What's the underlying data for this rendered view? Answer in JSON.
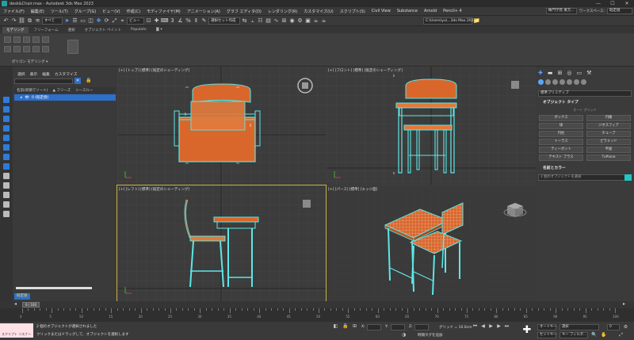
{
  "window": {
    "title": "desk&Chair.max - Autodesk 3ds Max 2023",
    "controls": [
      "—",
      "☐",
      "✕"
    ]
  },
  "menu": {
    "items": [
      "ファイル(F)",
      "編集(E)",
      "ツール(T)",
      "グループ(G)",
      "ビュー(V)",
      "作成(C)",
      "モディファイヤ(M)",
      "アニメーション(A)",
      "グラフ エディタ(D)",
      "レンダリング(R)",
      "カスタマイズ(U)",
      "スクリプト(S)",
      "Civil View",
      "Substance",
      "Arnold",
      "Pencil+ 4"
    ],
    "user_field": "株門学苑 東方...",
    "workspace_label": "ワークスペース:",
    "workspace_value": "既定値"
  },
  "toolbar": {
    "filter": "すべて",
    "selection_set": "選択セット作成",
    "path": "C:\\Users\\yu\\...3ds Max 2023"
  },
  "ribbon": {
    "tabs": [
      "モデリング",
      "フリーフォーム",
      "選択",
      "オブジェクト ペイント",
      "Populate"
    ],
    "active_tab": 0,
    "group_label": "ポリゴン モデリング ▾"
  },
  "scene_explorer": {
    "tabs": [
      "選択",
      "表示",
      "編集",
      "カスタマイズ"
    ],
    "header": [
      "名前(昇順でソート)",
      "▲ フリーズ",
      "シースルー"
    ],
    "row_label": "0 (既定値)",
    "status": "既定値"
  },
  "viewports": [
    {
      "label": "[+] [トップ] [標準] [既定のシェーディング]"
    },
    {
      "label": "[+] [フロント] [標準] [既定のシェーディング]"
    },
    {
      "label": "[+] [レフト] [標準] [既定のシェーディング]"
    },
    {
      "label": "[+] [パース] [標準] [エッジ面]"
    }
  ],
  "command_panel": {
    "dropdown": "標準プリミティブ",
    "section_type": "オブジェクト タイプ",
    "auto_grid": "オート グリッド",
    "buttons": [
      "ボックス",
      "円錐",
      "球",
      "ジオスフィア",
      "円柱",
      "チューブ",
      "トーラス",
      "ピラミッド",
      "ティーポット",
      "平面",
      "テキスト プラス",
      "TxPlane"
    ],
    "section_name": "名前とカラー",
    "name_placeholder": "2 個のオブジェクトを選択"
  },
  "timeline": {
    "frame": "0 / 100",
    "ticks": [
      "0",
      "5",
      "10",
      "15",
      "20",
      "25",
      "30",
      "35",
      "40",
      "45",
      "50",
      "55",
      "60",
      "65",
      "70",
      "75",
      "80",
      "85",
      "90",
      "95",
      "100"
    ]
  },
  "status": {
    "message": "2 個のオブジェクトが選択されました",
    "prompt": "クリックまたはドラッグして、オブジェクトを選択します",
    "script_label": "スクリプト リスナー",
    "x_label": "X:",
    "y_label": "Y:",
    "z_label": "Z:",
    "grid": "グリッド = 10.0cm",
    "add_time_tag": "時間タグを追加",
    "auto_key": "オートキー",
    "selection": "選択",
    "set_key": "セットキー",
    "key_filter": "キー フィルタ..."
  },
  "colors": {
    "accent": "#5aa6ff",
    "wireframe": "#5ee6e6",
    "wood": "#d9672c",
    "active_viewport": "#c9b040"
  }
}
